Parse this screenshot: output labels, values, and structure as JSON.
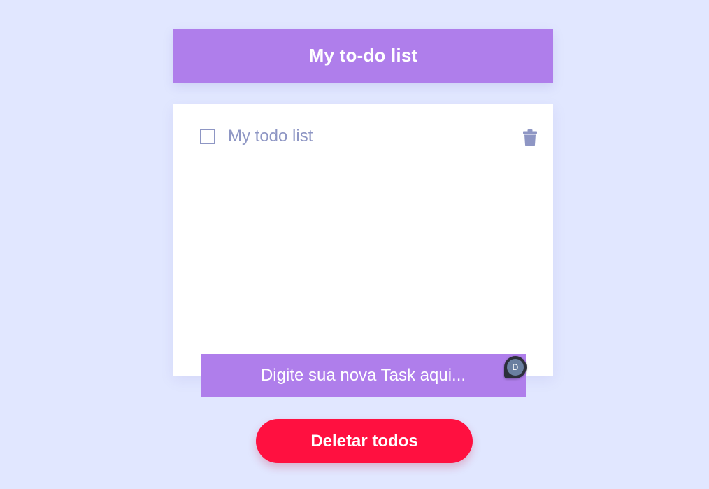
{
  "header": {
    "title": "My to-do list"
  },
  "todos": [
    {
      "text": "My todo list",
      "checked": false
    }
  ],
  "input": {
    "placeholder": "Digite sua nova Task aqui...",
    "value": ""
  },
  "badge": {
    "initial": "D"
  },
  "actions": {
    "delete_all_label": "Deletar todos"
  },
  "icons": {
    "delete_item": "trash-icon"
  },
  "colors": {
    "background": "#e1e7ff",
    "accent": "#af7eeb",
    "danger": "#ff1040",
    "muted_text": "#8e96c4"
  }
}
